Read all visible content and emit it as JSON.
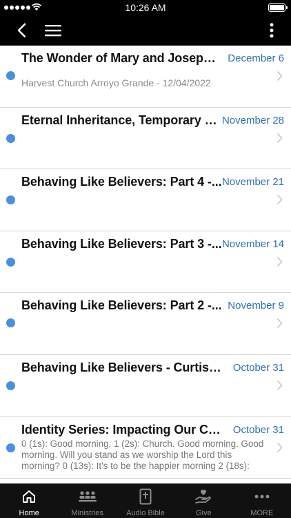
{
  "status_bar": {
    "time": "10:26 AM"
  },
  "nav": {
    "back_icon": "chevron-left-icon",
    "menu_icon": "hamburger-menu-icon",
    "more_icon": "vertical-ellipsis-icon"
  },
  "colors": {
    "accent": "#2d6fb3",
    "unread_dot": "#4a8fdc",
    "bar_background": "#000000"
  },
  "sermons": [
    {
      "title": "The Wonder of Mary and Joseph -...",
      "date": "December 6",
      "subtitle": "Harvest Church Arroyo Grande - 12/04/2022",
      "unread": true
    },
    {
      "title": "Eternal Inheritance, Temporary S...",
      "date": "November 28",
      "subtitle": "",
      "unread": true
    },
    {
      "title": "Behaving Like Believers: Part 4 -...",
      "date": "November 21",
      "subtitle": "",
      "unread": true
    },
    {
      "title": "Behaving Like Believers: Part 3 -...",
      "date": "November 14",
      "subtitle": "",
      "unread": true
    },
    {
      "title": "Behaving Like Believers: Part 2 -...",
      "date": "November 9",
      "subtitle": "",
      "unread": true
    },
    {
      "title": "Behaving Like Believers - Curtis H...",
      "date": "October 31",
      "subtitle": "",
      "unread": true
    },
    {
      "title": "Identity Series: Impacting Our Co...",
      "date": "October 31",
      "snippet": "0 (1s): Good morning, 1 (2s): Church. Good morning. Good morning. Will you stand as we worship the Lord this morning? 0 (13s): It's to be the happier morning 2 (18s):",
      "unread": true
    }
  ],
  "tabs": [
    {
      "label": "Home",
      "icon": "home-icon",
      "active": true
    },
    {
      "label": "Ministries",
      "icon": "people-group-icon",
      "active": false
    },
    {
      "label": "Audio Bible",
      "icon": "bible-icon",
      "active": false
    },
    {
      "label": "Give",
      "icon": "giving-hand-icon",
      "active": false
    },
    {
      "label": "MORE",
      "icon": "more-dots-icon",
      "active": false
    }
  ]
}
